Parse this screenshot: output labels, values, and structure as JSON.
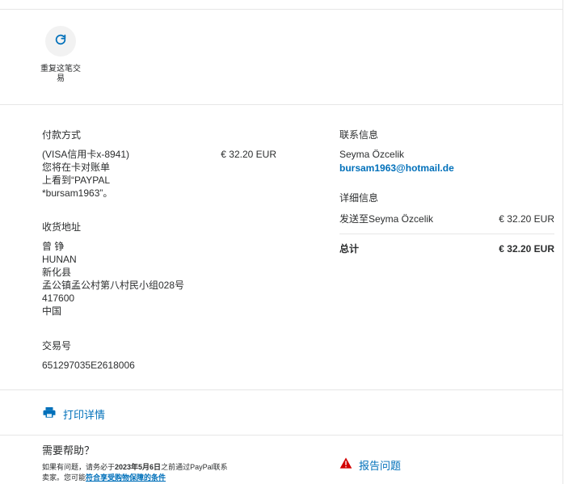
{
  "actions": {
    "repeat_label": "重复这笔交易"
  },
  "payment": {
    "title": "付款方式",
    "method_lines": [
      "(VISA信用卡x-8941)",
      "您将在卡对账单",
      "上看到“PAYPAL",
      "*bursam1963”。"
    ],
    "amount": "€ 32.20 EUR"
  },
  "shipping": {
    "title": "收货地址",
    "lines": [
      "曾 铮",
      "HUNAN",
      "新化县",
      "孟公镇孟公村第八村民小组028号",
      "417600",
      "中国"
    ]
  },
  "transaction": {
    "title": "交易号",
    "value": "651297035E2618006"
  },
  "contact": {
    "title": "联系信息",
    "name": "Seyma Özcelik",
    "email": "bursam1963@hotmail.de"
  },
  "details": {
    "title": "详细信息",
    "line_label": "发送至Seyma Özcelik",
    "line_amount": "€ 32.20 EUR",
    "total_label": "总计",
    "total_amount": "€ 32.20 EUR"
  },
  "print": {
    "label": "打印详情"
  },
  "help": {
    "title": "需要帮助？",
    "desc_prefix": "如果有问题，请务必于",
    "desc_date": "2023年5月6日",
    "desc_mid": "之前通过PayPal联系",
    "desc_line2_prefix": "卖家。您可能",
    "desc_link": "符合享受购物保障的条件"
  },
  "report": {
    "label": "报告问题"
  },
  "colors": {
    "link": "#0070ba",
    "warn": "#d20000"
  },
  "icons": {
    "repeat": "refresh-icon",
    "print": "printer-icon",
    "warn": "warning-icon"
  }
}
